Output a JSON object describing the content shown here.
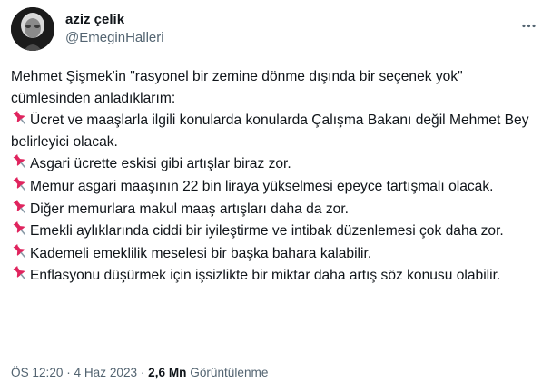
{
  "author": {
    "display_name": "aziz çelik",
    "handle": "@EmeginHalleri"
  },
  "tweet": {
    "intro_line_1": "Mehmet Şişmek'in \"rasyonel bir zemine dönme dışında bir seçenek yok\"",
    "intro_line_2": "cümlesinden anladıklarım:",
    "points": [
      "Ücret ve maaşlarla ilgili konularda konularda Çalışma Bakanı değil Mehmet Bey belirleyici olacak.",
      "Asgari ücrette eskisi gibi artışlar biraz zor.",
      "Memur asgari maaşının 22 bin liraya yükselmesi epeyce tartışmalı olacak.",
      "Diğer memurlara makul maaş artışları daha da zor.",
      "Emekli aylıklarında ciddi bir iyileştirme ve intibak düzenlemesi çok daha zor.",
      "Kademeli emeklilik meselesi bir başka bahara kalabilir.",
      "Enflasyonu düşürmek için işsizlikte bir miktar daha artış söz konusu olabilir."
    ],
    "bullet_icon": "pushpin-icon"
  },
  "meta": {
    "time": "ÖS 12:20",
    "separator": " · ",
    "date": "4 Haz 2023",
    "views_count": "2,6 Mn",
    "views_label": " Görüntülenme"
  },
  "colors": {
    "text": "#0f1419",
    "secondary": "#536471",
    "pin": "#e0245e"
  },
  "icons": {
    "more": "more-horizontal-icon"
  }
}
